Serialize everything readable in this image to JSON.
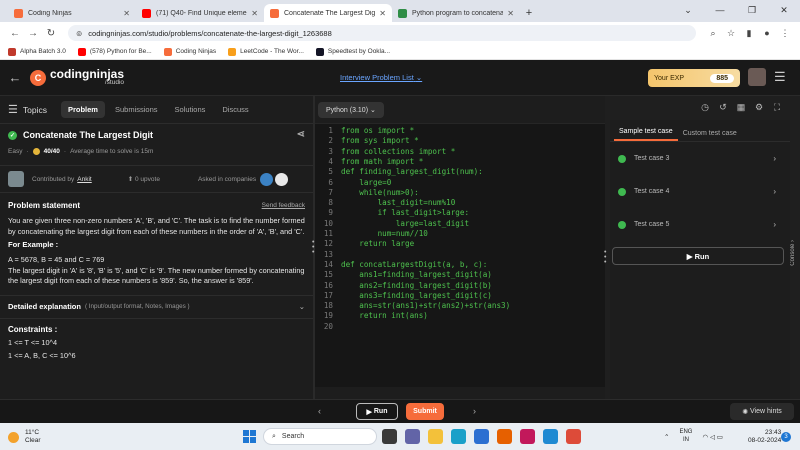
{
  "browser": {
    "tabs": [
      {
        "title": "Coding Ninjas",
        "favicon_color": "#f66c3b",
        "active": false
      },
      {
        "title": "(71) Q40- Find Unique elemen",
        "favicon_color": "#ff0000",
        "active": false
      },
      {
        "title": "Concatenate The Largest Digit",
        "favicon_color": "#f66c3b",
        "active": true
      },
      {
        "title": "Python program to concatenate",
        "favicon_color": "#2f8d46",
        "active": false
      }
    ],
    "new_tab_icon": "+",
    "url": "codingninjas.com/studio/problems/concatenate-the-largest-digit_1263688",
    "bookmarks": [
      {
        "label": "Alpha Batch 3.0",
        "color": "#c0392b"
      },
      {
        "label": "(578) Python for Be...",
        "color": "#ff0000"
      },
      {
        "label": "Coding Ninjas",
        "color": "#f66c3b"
      },
      {
        "label": "LeetCode - The Wor...",
        "color": "#f89f1b"
      },
      {
        "label": "Speedtest by Ookla...",
        "color": "#141526"
      }
    ]
  },
  "header": {
    "logo_main": "codingninjas",
    "logo_sub": "/studio",
    "logo_mark": "C",
    "interview_list": "Interview Problem List",
    "exp_label": "Your EXP",
    "exp_value": "885"
  },
  "left": {
    "topics_label": "Topics",
    "tabs": [
      "Problem",
      "Submissions",
      "Solutions",
      "Discuss"
    ],
    "active_tab": "Problem",
    "title": "Concatenate The Largest Digit",
    "difficulty": "Easy",
    "points": "40/40",
    "avg_time": "Average time to solve is 15m",
    "contributed_by": "Contributed by",
    "author": "Ankit",
    "upvotes": "0 upvote",
    "asked_in": "Asked in companies",
    "statement_heading": "Problem statement",
    "send_feedback": "Send feedback",
    "statement": "You are given three non-zero numbers 'A', 'B', and 'C'. The task is to find the number formed by concatenating the largest digit from each of these numbers in the order of 'A', 'B', and 'C'.",
    "example_heading": "For Example :",
    "example_input": "A = 5678, B = 45 and C = 769",
    "example_explain": "The largest digit in 'A' is '8', 'B' is '5', and 'C' is '9'. The new number formed by concatenating the largest digit from each of these numbers is '859'. So, the answer is '859'.",
    "detailed_heading": "Detailed explanation",
    "detailed_sub": "( Input/output format, Notes, Images )",
    "constraints_heading": "Constraints :",
    "constraints": [
      "1 <= T <= 10^4",
      "1 <= A, B, C <= 10^6"
    ]
  },
  "editor": {
    "language": "Python (3.10)",
    "lines": [
      "from os import *",
      "from sys import *",
      "from collections import *",
      "from math import *",
      "def finding_largest_digit(num):",
      "    large=0",
      "    while(num>0):",
      "        last_digit=num%10",
      "        if last_digit>large:",
      "            large=last_digit",
      "        num=num//10",
      "    return large",
      "",
      "def concatLargestDigit(a, b, c):",
      "    ans1=finding_largest_digit(a)",
      "    ans2=finding_largest_digit(b)",
      "    ans3=finding_largest_digit(c)",
      "    ans=str(ans1)+str(ans2)+str(ans3)",
      "    return int(ans)",
      ""
    ]
  },
  "right": {
    "tabs": [
      "Sample test case",
      "Custom test case"
    ],
    "active_tab": "Sample test case",
    "cases": [
      "Test case 3",
      "Test case 4",
      "Test case 5"
    ],
    "run_label": "Run",
    "console_label": "Console"
  },
  "bottom": {
    "run_label": "Run",
    "submit_label": "Submit",
    "hints_label": "View hints"
  },
  "taskbar": {
    "temp": "11°C",
    "weather": "Clear",
    "search_placeholder": "Search",
    "lang_top": "ENG",
    "lang_bottom": "IN",
    "time": "23:43",
    "date": "08-02-2024",
    "notifications": "3"
  },
  "colors": {
    "accent": "#f66c3b",
    "code_green": "#4ec24e",
    "success": "#3fb950",
    "link_blue": "#6aa5ff"
  }
}
